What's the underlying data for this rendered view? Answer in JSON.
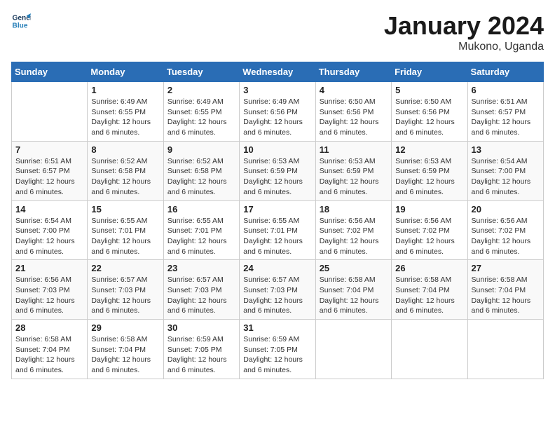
{
  "logo": {
    "line1": "General",
    "line2": "Blue"
  },
  "title": "January 2024",
  "subtitle": "Mukono, Uganda",
  "days_header": [
    "Sunday",
    "Monday",
    "Tuesday",
    "Wednesday",
    "Thursday",
    "Friday",
    "Saturday"
  ],
  "weeks": [
    [
      {
        "day": "",
        "info": ""
      },
      {
        "day": "1",
        "info": "Sunrise: 6:49 AM\nSunset: 6:55 PM\nDaylight: 12 hours\nand 6 minutes."
      },
      {
        "day": "2",
        "info": "Sunrise: 6:49 AM\nSunset: 6:55 PM\nDaylight: 12 hours\nand 6 minutes."
      },
      {
        "day": "3",
        "info": "Sunrise: 6:49 AM\nSunset: 6:56 PM\nDaylight: 12 hours\nand 6 minutes."
      },
      {
        "day": "4",
        "info": "Sunrise: 6:50 AM\nSunset: 6:56 PM\nDaylight: 12 hours\nand 6 minutes."
      },
      {
        "day": "5",
        "info": "Sunrise: 6:50 AM\nSunset: 6:56 PM\nDaylight: 12 hours\nand 6 minutes."
      },
      {
        "day": "6",
        "info": "Sunrise: 6:51 AM\nSunset: 6:57 PM\nDaylight: 12 hours\nand 6 minutes."
      }
    ],
    [
      {
        "day": "7",
        "info": "Sunrise: 6:51 AM\nSunset: 6:57 PM\nDaylight: 12 hours\nand 6 minutes."
      },
      {
        "day": "8",
        "info": "Sunrise: 6:52 AM\nSunset: 6:58 PM\nDaylight: 12 hours\nand 6 minutes."
      },
      {
        "day": "9",
        "info": "Sunrise: 6:52 AM\nSunset: 6:58 PM\nDaylight: 12 hours\nand 6 minutes."
      },
      {
        "day": "10",
        "info": "Sunrise: 6:53 AM\nSunset: 6:59 PM\nDaylight: 12 hours\nand 6 minutes."
      },
      {
        "day": "11",
        "info": "Sunrise: 6:53 AM\nSunset: 6:59 PM\nDaylight: 12 hours\nand 6 minutes."
      },
      {
        "day": "12",
        "info": "Sunrise: 6:53 AM\nSunset: 6:59 PM\nDaylight: 12 hours\nand 6 minutes."
      },
      {
        "day": "13",
        "info": "Sunrise: 6:54 AM\nSunset: 7:00 PM\nDaylight: 12 hours\nand 6 minutes."
      }
    ],
    [
      {
        "day": "14",
        "info": "Sunrise: 6:54 AM\nSunset: 7:00 PM\nDaylight: 12 hours\nand 6 minutes."
      },
      {
        "day": "15",
        "info": "Sunrise: 6:55 AM\nSunset: 7:01 PM\nDaylight: 12 hours\nand 6 minutes."
      },
      {
        "day": "16",
        "info": "Sunrise: 6:55 AM\nSunset: 7:01 PM\nDaylight: 12 hours\nand 6 minutes."
      },
      {
        "day": "17",
        "info": "Sunrise: 6:55 AM\nSunset: 7:01 PM\nDaylight: 12 hours\nand 6 minutes."
      },
      {
        "day": "18",
        "info": "Sunrise: 6:56 AM\nSunset: 7:02 PM\nDaylight: 12 hours\nand 6 minutes."
      },
      {
        "day": "19",
        "info": "Sunrise: 6:56 AM\nSunset: 7:02 PM\nDaylight: 12 hours\nand 6 minutes."
      },
      {
        "day": "20",
        "info": "Sunrise: 6:56 AM\nSunset: 7:02 PM\nDaylight: 12 hours\nand 6 minutes."
      }
    ],
    [
      {
        "day": "21",
        "info": "Sunrise: 6:56 AM\nSunset: 7:03 PM\nDaylight: 12 hours\nand 6 minutes."
      },
      {
        "day": "22",
        "info": "Sunrise: 6:57 AM\nSunset: 7:03 PM\nDaylight: 12 hours\nand 6 minutes."
      },
      {
        "day": "23",
        "info": "Sunrise: 6:57 AM\nSunset: 7:03 PM\nDaylight: 12 hours\nand 6 minutes."
      },
      {
        "day": "24",
        "info": "Sunrise: 6:57 AM\nSunset: 7:03 PM\nDaylight: 12 hours\nand 6 minutes."
      },
      {
        "day": "25",
        "info": "Sunrise: 6:58 AM\nSunset: 7:04 PM\nDaylight: 12 hours\nand 6 minutes."
      },
      {
        "day": "26",
        "info": "Sunrise: 6:58 AM\nSunset: 7:04 PM\nDaylight: 12 hours\nand 6 minutes."
      },
      {
        "day": "27",
        "info": "Sunrise: 6:58 AM\nSunset: 7:04 PM\nDaylight: 12 hours\nand 6 minutes."
      }
    ],
    [
      {
        "day": "28",
        "info": "Sunrise: 6:58 AM\nSunset: 7:04 PM\nDaylight: 12 hours\nand 6 minutes."
      },
      {
        "day": "29",
        "info": "Sunrise: 6:58 AM\nSunset: 7:04 PM\nDaylight: 12 hours\nand 6 minutes."
      },
      {
        "day": "30",
        "info": "Sunrise: 6:59 AM\nSunset: 7:05 PM\nDaylight: 12 hours\nand 6 minutes."
      },
      {
        "day": "31",
        "info": "Sunrise: 6:59 AM\nSunset: 7:05 PM\nDaylight: 12 hours\nand 6 minutes."
      },
      {
        "day": "",
        "info": ""
      },
      {
        "day": "",
        "info": ""
      },
      {
        "day": "",
        "info": ""
      }
    ]
  ]
}
